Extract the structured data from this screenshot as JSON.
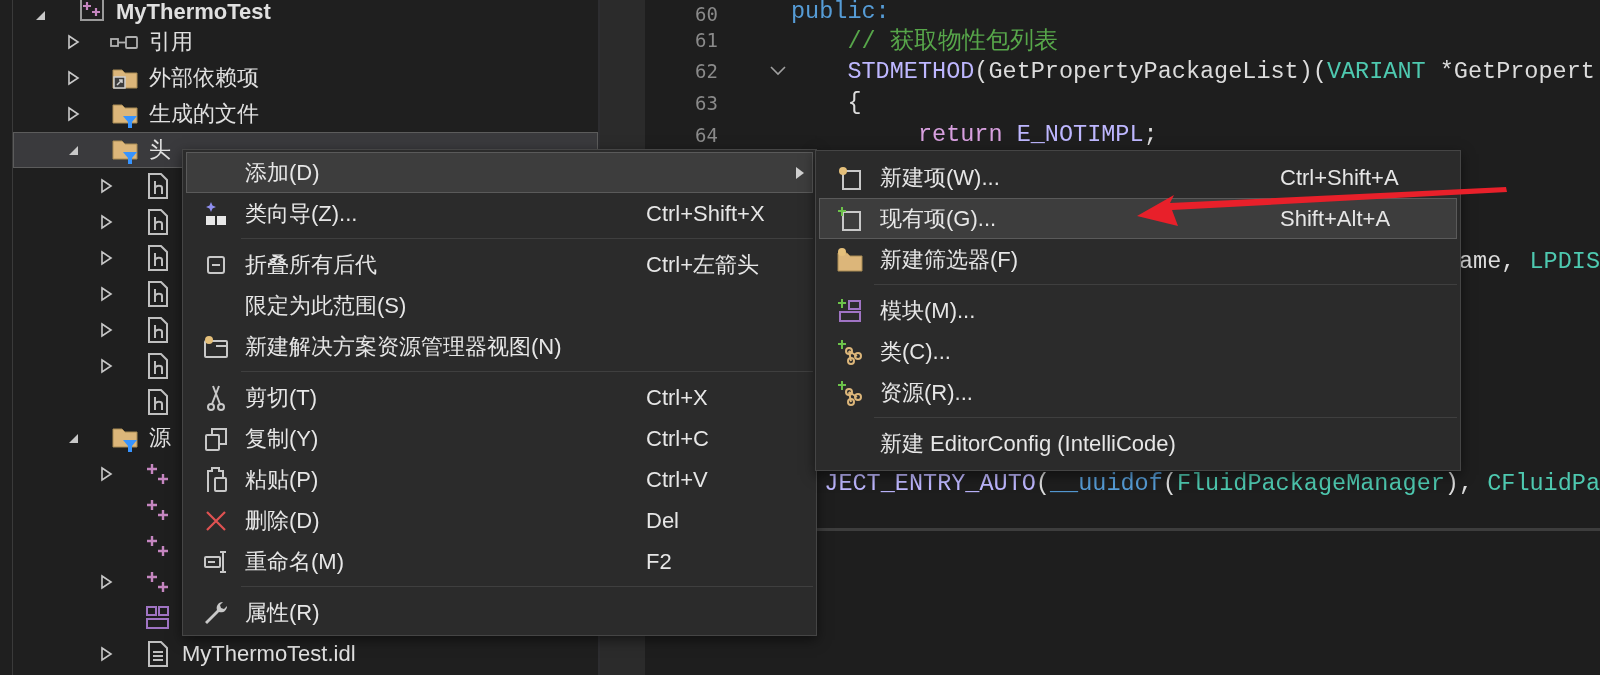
{
  "solution_explorer": {
    "tree": [
      {
        "label": "MyThermoTest",
        "kind": "project",
        "expanded": true,
        "selected": false,
        "children": [
          {
            "label": "引用",
            "kind": "references",
            "expanded": false,
            "selected": false
          },
          {
            "label": "外部依赖项",
            "kind": "external",
            "expanded": false,
            "selected": false
          },
          {
            "label": "生成的文件",
            "kind": "filter",
            "expanded": false,
            "selected": false
          },
          {
            "label": "头",
            "kind": "filter",
            "expanded": true,
            "selected": true,
            "children": [
              {
                "kind": "header",
                "expanded": false,
                "selected": false
              },
              {
                "kind": "header",
                "expanded": false,
                "selected": false
              },
              {
                "kind": "header",
                "expanded": false,
                "selected": false
              },
              {
                "kind": "header",
                "expanded": false,
                "selected": false
              },
              {
                "kind": "header",
                "expanded": false,
                "selected": false
              },
              {
                "kind": "header",
                "expanded": false,
                "selected": false
              },
              {
                "kind": "header",
                "selected": false
              }
            ]
          },
          {
            "label": "源",
            "kind": "filter",
            "expanded": true,
            "selected": false,
            "children": [
              {
                "kind": "source",
                "expanded": false,
                "selected": false
              },
              {
                "kind": "source",
                "selected": false
              },
              {
                "kind": "source",
                "selected": false
              },
              {
                "kind": "source",
                "expanded": false,
                "selected": false
              },
              {
                "kind": "resource",
                "selected": false
              },
              {
                "label": "MyThermoTest.idl",
                "kind": "idl",
                "expanded": false,
                "selected": false
              }
            ]
          }
        ]
      }
    ]
  },
  "editor": {
    "lines": [
      {
        "number": "60",
        "tokens": [
          {
            "text": "public:",
            "kind": "keyword"
          }
        ]
      },
      {
        "number": "61",
        "tokens": [
          {
            "text": "    // 获取物性包列表",
            "kind": "comment"
          }
        ]
      },
      {
        "number": "62",
        "fold": true,
        "tokens": [
          {
            "text": "    STDMETHOD",
            "kind": "macro"
          },
          {
            "text": "(GetPropertyPackageList)(",
            "kind": "plain"
          },
          {
            "text": "VARIANT",
            "kind": "type"
          },
          {
            "text": " *GetPropert",
            "kind": "plain"
          }
        ]
      },
      {
        "number": "63",
        "tokens": [
          {
            "text": "    {",
            "kind": "plain"
          }
        ]
      },
      {
        "number": "64",
        "tokens": [
          {
            "text": "         return",
            "kind": "control"
          },
          {
            "text": " E_NOTIMPL",
            "kind": "macro"
          },
          {
            "text": ";",
            "kind": "plain"
          }
        ]
      },
      {
        "kind": "tail",
        "tokens": [
          {
            "text": "ame, ",
            "kind": "plain"
          },
          {
            "text": "LPDIS",
            "kind": "type"
          }
        ]
      },
      {
        "kind": "tail",
        "tokens": [
          {
            "text": "JECT_ENTRY_AUTO",
            "kind": "macro"
          },
          {
            "text": "(",
            "kind": "plain"
          },
          {
            "text": "__uuidof",
            "kind": "keyword"
          },
          {
            "text": "(",
            "kind": "plain"
          },
          {
            "text": "FluidPackageManager",
            "kind": "type"
          },
          {
            "text": "), ",
            "kind": "plain"
          },
          {
            "text": "CFluidPa",
            "kind": "type"
          }
        ]
      }
    ]
  },
  "context_menu": {
    "items": [
      {
        "kind": "item",
        "label": "添加(D)",
        "has_submenu": true,
        "selected": true
      },
      {
        "kind": "item",
        "label": "类向导(Z)...",
        "shortcut": "Ctrl+Shift+X",
        "has_submenu": false,
        "selected": false
      },
      {
        "kind": "separator"
      },
      {
        "kind": "item",
        "label": "折叠所有后代",
        "shortcut": "Ctrl+左箭头",
        "has_submenu": false,
        "selected": false
      },
      {
        "kind": "item",
        "label": "限定为此范围(S)",
        "has_submenu": false,
        "selected": false
      },
      {
        "kind": "item",
        "label": "新建解决方案资源管理器视图(N)",
        "has_submenu": false,
        "selected": false
      },
      {
        "kind": "separator"
      },
      {
        "kind": "item",
        "label": "剪切(T)",
        "shortcut": "Ctrl+X",
        "has_submenu": false,
        "selected": false
      },
      {
        "kind": "item",
        "label": "复制(Y)",
        "shortcut": "Ctrl+C",
        "has_submenu": false,
        "selected": false
      },
      {
        "kind": "item",
        "label": "粘贴(P)",
        "shortcut": "Ctrl+V",
        "has_submenu": false,
        "selected": false
      },
      {
        "kind": "item",
        "label": "删除(D)",
        "shortcut": "Del",
        "has_submenu": false,
        "selected": false
      },
      {
        "kind": "item",
        "label": "重命名(M)",
        "shortcut": "F2",
        "has_submenu": false,
        "selected": false
      },
      {
        "kind": "separator"
      },
      {
        "kind": "item",
        "label": "属性(R)",
        "has_submenu": false,
        "selected": false
      }
    ]
  },
  "submenu": {
    "items": [
      {
        "kind": "item",
        "label": "新建项(W)...",
        "shortcut": "Ctrl+Shift+A",
        "selected": false
      },
      {
        "kind": "item",
        "label": "现有项(G)...",
        "shortcut": "Shift+Alt+A",
        "selected": true
      },
      {
        "kind": "item",
        "label": "新建筛选器(F)",
        "selected": false
      },
      {
        "kind": "separator"
      },
      {
        "kind": "item",
        "label": "模块(M)...",
        "selected": false
      },
      {
        "kind": "item",
        "label": "类(C)...",
        "selected": false
      },
      {
        "kind": "item",
        "label": "资源(R)...",
        "selected": false
      },
      {
        "kind": "separator"
      },
      {
        "kind": "item",
        "label": "新建 EditorConfig (IntelliCode)",
        "selected": false
      }
    ]
  },
  "annotations": [
    {
      "kind": "arrow"
    }
  ]
}
